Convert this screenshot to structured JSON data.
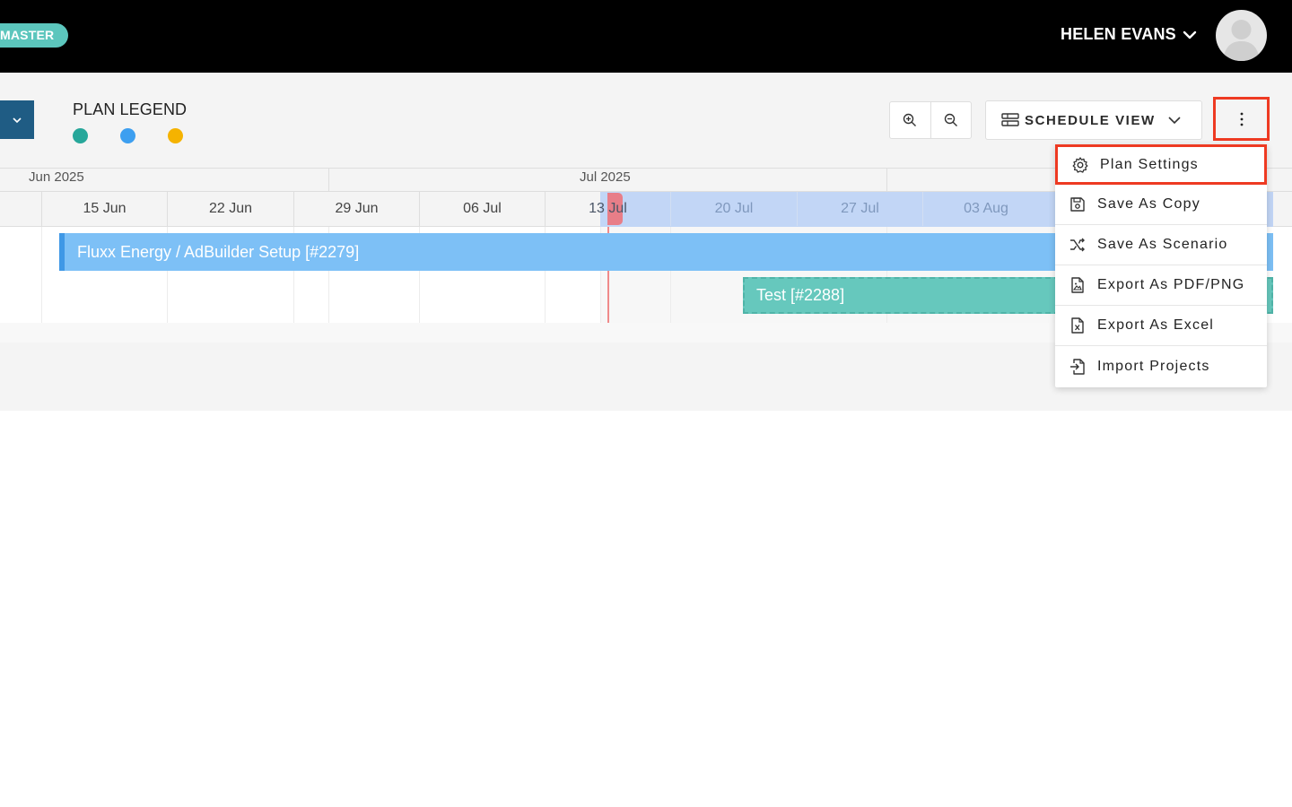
{
  "topbar": {
    "badge": "MASTER",
    "user_name": "HELEN EVANS"
  },
  "toolbar": {
    "legend_title": "PLAN LEGEND",
    "legend_colors": [
      "#27a79a",
      "#3d9ff0",
      "#f5b300"
    ],
    "schedule_view_label": "SCHEDULE VIEW"
  },
  "timeline": {
    "months": [
      "Jun 2025",
      "Jul 2025"
    ],
    "weeks": [
      "15 Jun",
      "22 Jun",
      "29 Jun",
      "06 Jul",
      "13 Jul",
      "20 Jul",
      "27 Jul",
      "03 Aug"
    ],
    "bars": [
      {
        "label": "Fluxx Energy / AdBuilder Setup [#2279]",
        "color": "#7dc0f6"
      },
      {
        "label": "Test [#2288]",
        "color": "#66c8bd"
      }
    ]
  },
  "menu": {
    "items": [
      {
        "label": "Plan Settings",
        "icon": "gear-icon"
      },
      {
        "label": "Save As Copy",
        "icon": "floppy-icon"
      },
      {
        "label": "Save As Scenario",
        "icon": "shuffle-icon"
      },
      {
        "label": "Export As PDF/PNG",
        "icon": "file-image-icon"
      },
      {
        "label": "Export As Excel",
        "icon": "file-excel-icon"
      },
      {
        "label": "Import Projects",
        "icon": "file-import-icon"
      }
    ]
  }
}
